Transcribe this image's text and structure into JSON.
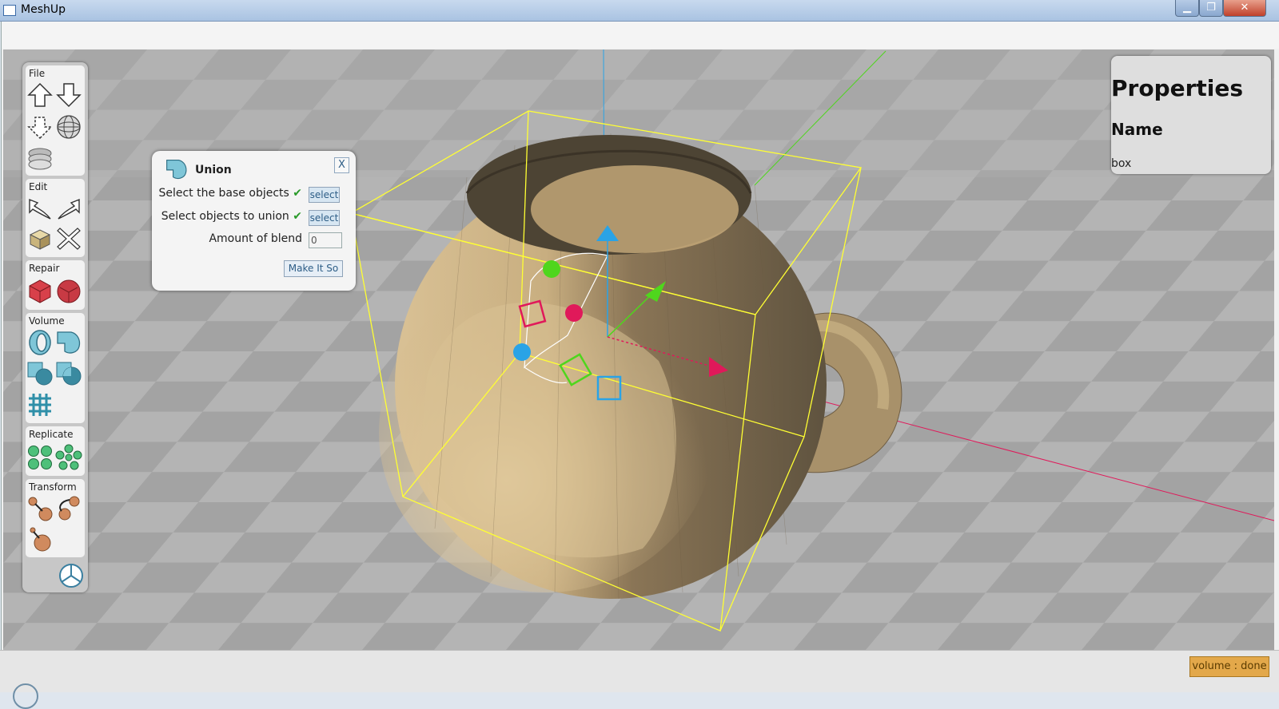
{
  "window": {
    "title": "MeshUp",
    "minimize": "▁",
    "maximize": "❐",
    "close": "✕"
  },
  "toolbox": {
    "sections": [
      {
        "label": "File",
        "tools": [
          "import-up-icon",
          "export-down-icon",
          "export-selection-icon",
          "mesh-sphere-icon",
          "layers-icon"
        ]
      },
      {
        "label": "Edit",
        "tools": [
          "undo-icon",
          "redo-icon",
          "duplicate-icon",
          "delete-icon"
        ]
      },
      {
        "label": "Repair",
        "tools": [
          "repair-mesh-icon",
          "repair-solid-icon"
        ]
      },
      {
        "label": "Volume",
        "tools": [
          "hollow-icon",
          "union-icon",
          "subtract-icon",
          "intersect-icon",
          "grid-icon"
        ]
      },
      {
        "label": "Replicate",
        "tools": [
          "replicate-grid-icon",
          "replicate-circular-icon"
        ]
      },
      {
        "label": "Transform",
        "tools": [
          "move-icon",
          "rotate-icon",
          "scale-icon"
        ]
      }
    ],
    "footer_icon": "view-cube-icon"
  },
  "union_dialog": {
    "title": "Union",
    "close": "X",
    "rows": [
      {
        "label": "Select the base objects",
        "check": "✔",
        "button": "select"
      },
      {
        "label": "Select objects to union",
        "check": "✔",
        "button": "select"
      }
    ],
    "blend_label": "Amount of blend",
    "blend_value": "0",
    "submit": "Make It So"
  },
  "properties": {
    "title": "Properties",
    "name_label": "Name",
    "name_value": "box"
  },
  "status": {
    "badge": "volume : done"
  },
  "colors": {
    "accent": "#e3a84a",
    "selection_box": "#ffff33",
    "axis_x": "#e0195a",
    "axis_y": "#4fd61d",
    "axis_z": "#2aa3e6",
    "mug_light": "#d4bb8d",
    "mug_dark": "#6e6048"
  }
}
